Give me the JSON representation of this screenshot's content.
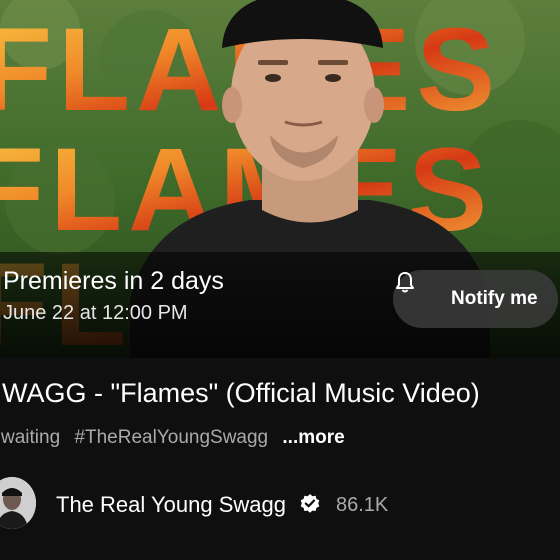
{
  "premiere": {
    "title": "Premieres in 2 days",
    "date": "June 22 at 12:00 PM",
    "notify_label": "Notify me"
  },
  "thumbnail": {
    "overlay_text": [
      "FLAMES",
      "FLAMES",
      "FLAMES"
    ]
  },
  "video": {
    "title": "WAGG - \"Flames\" (Official Music Video)",
    "tags": [
      "waiting",
      "#TheRealYoungSwagg"
    ],
    "more_label": "...more"
  },
  "channel": {
    "name": "The Real Young Swagg",
    "subscribers": "86.1K",
    "verified_icon": "verified-badge-icon"
  },
  "colors": {
    "background": "#0f0f0f",
    "flame_orange": "#e8531c",
    "flame_yellow": "#f7c842",
    "button_bg": "#3c3c3c",
    "meta_gray": "#aaaaaa"
  }
}
